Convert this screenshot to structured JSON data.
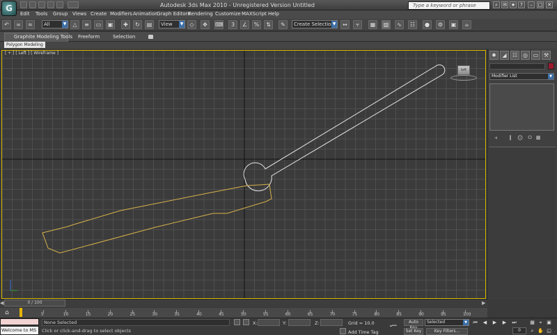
{
  "titlebar": {
    "title": "Autodesk 3ds Max  2010   -  Unregistered Version   Untitled",
    "search_placeholder": "Type a keyword or phrase",
    "logo_glyph": "G"
  },
  "menu": [
    "Edit",
    "Tools",
    "Group",
    "Views",
    "Create",
    "Modifiers",
    "Animation",
    "Graph Editors",
    "Rendering",
    "Customize",
    "MAXScript",
    "Help"
  ],
  "toolbar": {
    "selection_filter": "All",
    "reference_coord": "View",
    "named_selection": "Create Selection Se"
  },
  "ribbon": {
    "tabs": [
      "Graphite Modeling Tools",
      "Freeform",
      "Selection"
    ],
    "panel_label": "Polygon Modeling"
  },
  "viewport": {
    "label": "[ + ] [ Left ] [ Wireframe ]",
    "viewcube_label": "left",
    "grid_color": "#4f4f4f",
    "axis_color": "#111111",
    "border_color": "#d9b800",
    "shape_colors": {
      "selected": "#d8b24a",
      "unselected": "#e6e6e6"
    }
  },
  "command_panel": {
    "modifier_list": "Modifier List",
    "object_color": "#9a1a30"
  },
  "timeline": {
    "time_display": "0 / 100",
    "ticks": [
      5,
      10,
      15,
      20,
      25,
      30,
      35,
      40,
      45,
      50,
      55,
      60,
      65,
      70,
      75,
      80,
      85,
      90,
      95,
      100
    ]
  },
  "status": {
    "maxscript": "Welcome to MS",
    "selection_status": "None Selected",
    "prompt": "Click or click-and-drag to select objects",
    "coord_x_label": "X:",
    "coord_y_label": "Y:",
    "coord_z_label": "Z:",
    "grid": "Grid = 10.0",
    "add_time_tag": "Add Time Tag",
    "auto_key": "Auto Key",
    "set_key": "Set Key",
    "selected_mode": "Selected",
    "key_filters": "Key Filters...",
    "frame": "0"
  }
}
